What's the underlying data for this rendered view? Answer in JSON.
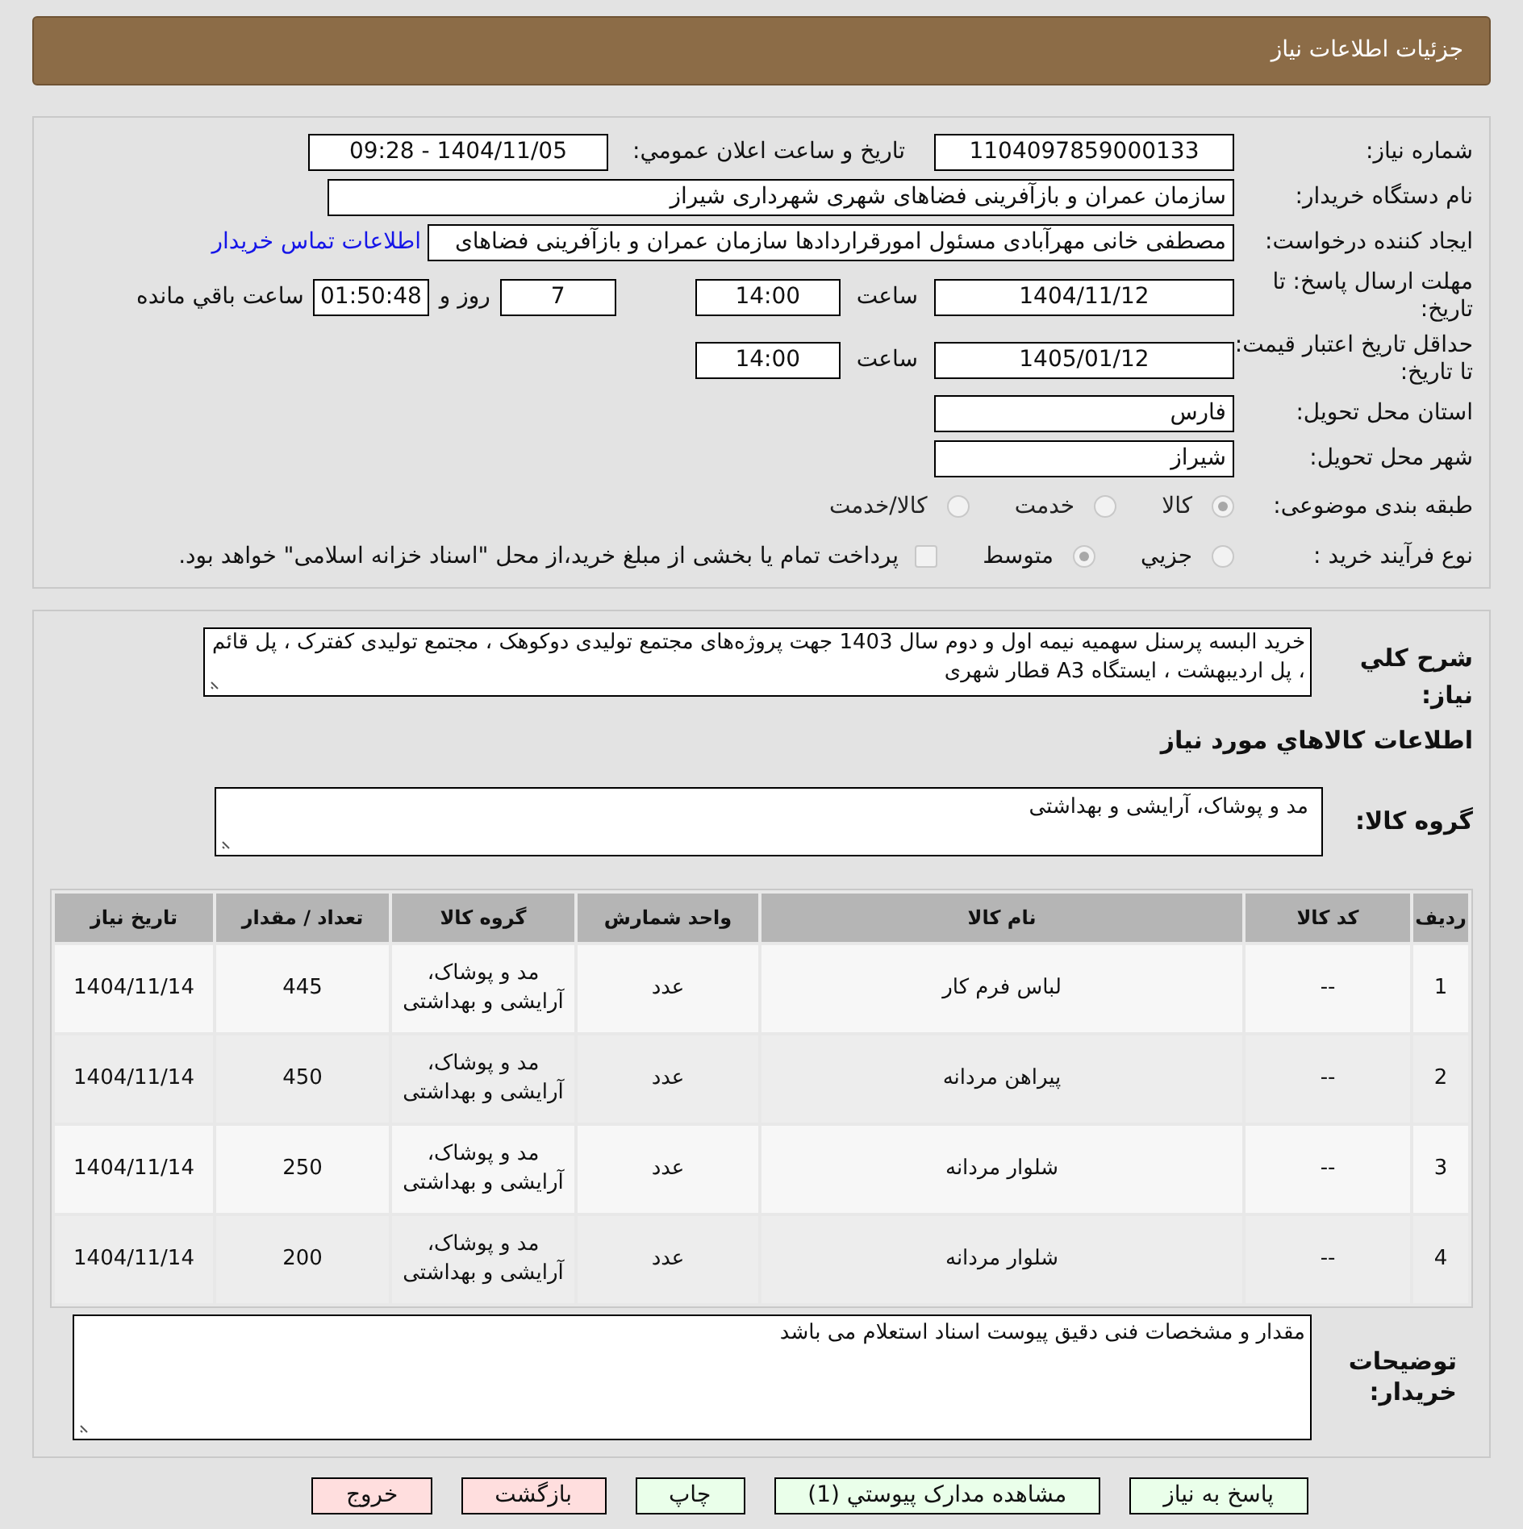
{
  "header": {
    "title": "جزئیات اطلاعات نیاز"
  },
  "details": {
    "need_number": {
      "label": "شماره نیاز:",
      "value": "1104097859000133"
    },
    "announce": {
      "label": "تاریخ و ساعت اعلان عمومي:",
      "value": "1404/11/05 - 09:28"
    },
    "buyer": {
      "label": "نام دستگاه خریدار:",
      "value": "سازمان عمران و بازآفرینی فضاهای شهری شهرداری شیراز"
    },
    "requester": {
      "label": "ایجاد کننده درخواست:",
      "value": "مصطفی خانی مهرآبادی مسئول امورقراردادها سازمان عمران و بازآفرینی فضاهای",
      "link": "اطلاعات تماس خریدار"
    },
    "deadline": {
      "label": "مهلت ارسال پاسخ: تا تاریخ:",
      "date": "1404/11/12",
      "time_label": "ساعت",
      "time": "14:00",
      "days": "7",
      "days_label": "روز و",
      "remaining": "01:50:48",
      "remaining_label": "ساعت باقي مانده"
    },
    "validity": {
      "label": "حداقل تاریخ اعتبار قیمت: تا تاریخ:",
      "date": "1405/01/12",
      "time_label": "ساعت",
      "time": "14:00"
    },
    "province": {
      "label": "استان محل تحویل:",
      "value": "فارس"
    },
    "city": {
      "label": "شهر محل تحویل:",
      "value": "شیراز"
    },
    "category": {
      "label": "طبقه بندی موضوعی:",
      "options": [
        {
          "label": "کالا",
          "selected": true
        },
        {
          "label": "خدمت",
          "selected": false
        },
        {
          "label": "کالا/خدمت",
          "selected": false
        }
      ]
    },
    "process": {
      "label": "نوع فرآیند خرید :",
      "options": [
        {
          "label": "جزيي",
          "selected": false
        },
        {
          "label": "متوسط",
          "selected": true
        }
      ],
      "checkbox": {
        "label": "پرداخت تمام یا بخشی از مبلغ خرید،از محل \"اسناد خزانه اسلامی\" خواهد بود.",
        "checked": false
      }
    }
  },
  "summary": {
    "label": "شرح كلي نياز:",
    "value": "خرید البسه پرسنل سهمیه نیمه اول و دوم سال 1403 جهت پروژه‌های مجتمع تولیدی دوکوهک ، مجتمع تولیدی کفترک ، پل قائم ، پل اردیبهشت ، ایستگاه A3 قطار شهری"
  },
  "goods_title": "اطلاعات كالاهاي مورد نياز",
  "goods_group": {
    "label": "گروه کالا:",
    "value": "مد و پوشاک، آرایشی و بهداشتی"
  },
  "table": {
    "columns": [
      "ردیف",
      "کد کالا",
      "نام کالا",
      "واحد شمارش",
      "گروه کالا",
      "تعداد / مقدار",
      "تاریخ نیاز"
    ],
    "rows": [
      [
        "1",
        "--",
        "لباس فرم کار",
        "عدد",
        "مد و پوشاک، آرایشی و بهداشتی",
        "445",
        "1404/11/14"
      ],
      [
        "2",
        "--",
        "پیراهن مردانه",
        "عدد",
        "مد و پوشاک، آرایشی و بهداشتی",
        "450",
        "1404/11/14"
      ],
      [
        "3",
        "--",
        "شلوار مردانه",
        "عدد",
        "مد و پوشاک، آرایشی و بهداشتی",
        "250",
        "1404/11/14"
      ],
      [
        "4",
        "--",
        "شلوار مردانه",
        "عدد",
        "مد و پوشاک، آرایشی و بهداشتی",
        "200",
        "1404/11/14"
      ]
    ]
  },
  "notes": {
    "label": "توضیحات خریدار:",
    "value": "مقدار و مشخصات فنی دقیق پیوست اسناد استعلام می باشد"
  },
  "buttons": [
    {
      "label": "پاسخ به نیاز",
      "kind": "primary"
    },
    {
      "label": "مشاهده مدارک پیوستي (1)",
      "kind": "primary"
    },
    {
      "label": "چاپ",
      "kind": "primary"
    },
    {
      "label": "بازگشت",
      "kind": "danger"
    },
    {
      "label": "خروج",
      "kind": "danger"
    }
  ]
}
